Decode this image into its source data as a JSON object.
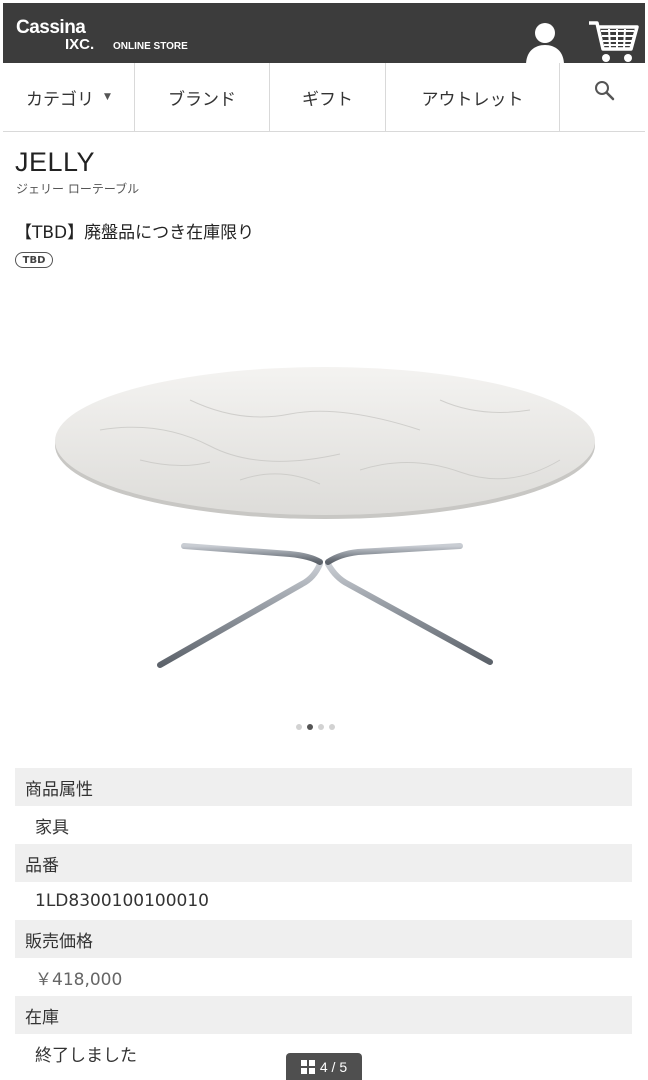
{
  "header": {
    "logo_top": "Cassina",
    "logo_sub": "IXC.",
    "logo_store": "ONLINE STORE",
    "icons": [
      "user-icon",
      "cart-icon"
    ],
    "background": "#3c3c3c"
  },
  "nav": {
    "items": [
      {
        "label": "カテゴリ",
        "has_dropdown": true
      },
      {
        "label": "ブランド"
      },
      {
        "label": "ギフト"
      },
      {
        "label": "アウトレット"
      }
    ],
    "dropdown_arrow": "▼",
    "search_icon": "search-icon"
  },
  "product": {
    "name": "JELLY",
    "subtitle": "ジェリー ローテーブル",
    "notice": "【TBD】廃盤品につき在庫限り",
    "badge": "TBD"
  },
  "gallery": {
    "dot_count": 4,
    "active_dot": 2,
    "counter": "4 / 5"
  },
  "specs": [
    {
      "label": "商品属性",
      "value": "家具"
    },
    {
      "label": "品番",
      "value": "1LD8300100100010"
    },
    {
      "label": "販売価格",
      "value": "￥418,000"
    },
    {
      "label": "在庫",
      "value": "終了しました"
    }
  ]
}
